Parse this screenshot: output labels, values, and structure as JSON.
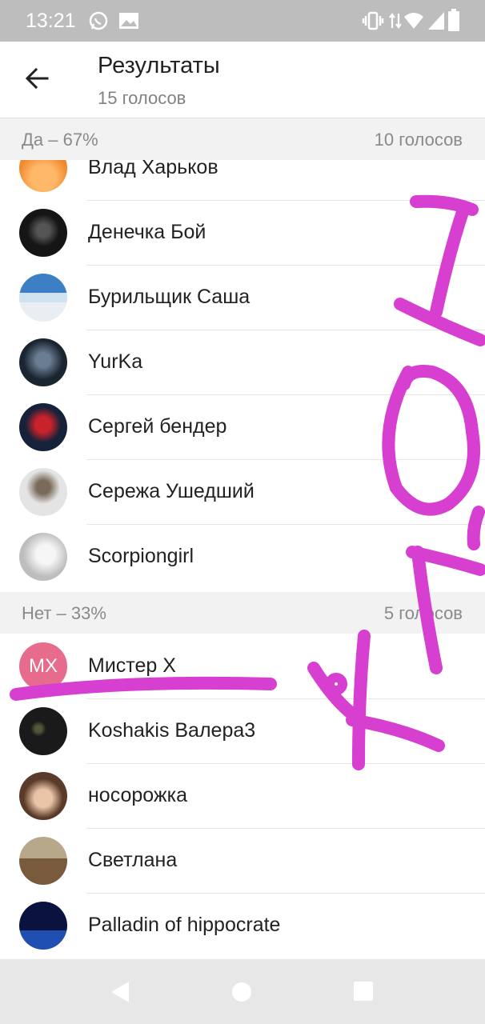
{
  "status_bar": {
    "time": "13:21",
    "icons": [
      "whatsapp-icon",
      "gallery-icon",
      "vibrate-icon",
      "data-arrows-icon",
      "wifi-icon",
      "signal-icon",
      "battery-icon"
    ]
  },
  "app_bar": {
    "back_icon": "arrow-left-icon",
    "title": "Результаты",
    "subtitle": "15 голосов"
  },
  "sections": [
    {
      "label": "Да – 67%",
      "count": "10 голосов",
      "voters": [
        {
          "name": "Влад Харьков",
          "avatar_color": "#f4a04a"
        },
        {
          "name": "Денечка Бой",
          "avatar_color": "#151515"
        },
        {
          "name": "Бурильщик Саша",
          "avatar_color": "#6f9fcf"
        },
        {
          "name": "YurKa",
          "avatar_color": "#1b2530"
        },
        {
          "name": "Сергей бендер",
          "avatar_color": "#16213a"
        },
        {
          "name": "Сережа Ушедший",
          "avatar_color": "#d8d8d8"
        },
        {
          "name": "Scorpiongirl",
          "avatar_color": "#e3e3e3"
        }
      ]
    },
    {
      "label": "Нет – 33%",
      "count": "5 голосов",
      "voters": [
        {
          "name": "Мистер X",
          "avatar_color": "#e66b8c",
          "initials": "MX"
        },
        {
          "name": "Koshakis Валера3",
          "avatar_color": "#1a1a1a"
        },
        {
          "name": "носорожка",
          "avatar_color": "#b98a6a"
        },
        {
          "name": "Светлана",
          "avatar_color": "#8a7458"
        },
        {
          "name": "Palladin of hippocrate",
          "avatar_color": "#0e1e5a"
        }
      ]
    }
  ],
  "nav_bar": {
    "icons": [
      "nav-back-icon",
      "nav-home-icon",
      "nav-recents-icon"
    ]
  },
  "colors": {
    "scribble": "#d63fd0",
    "section_background": "#f2f2f2",
    "status_bar": "#bdbdbd"
  }
}
